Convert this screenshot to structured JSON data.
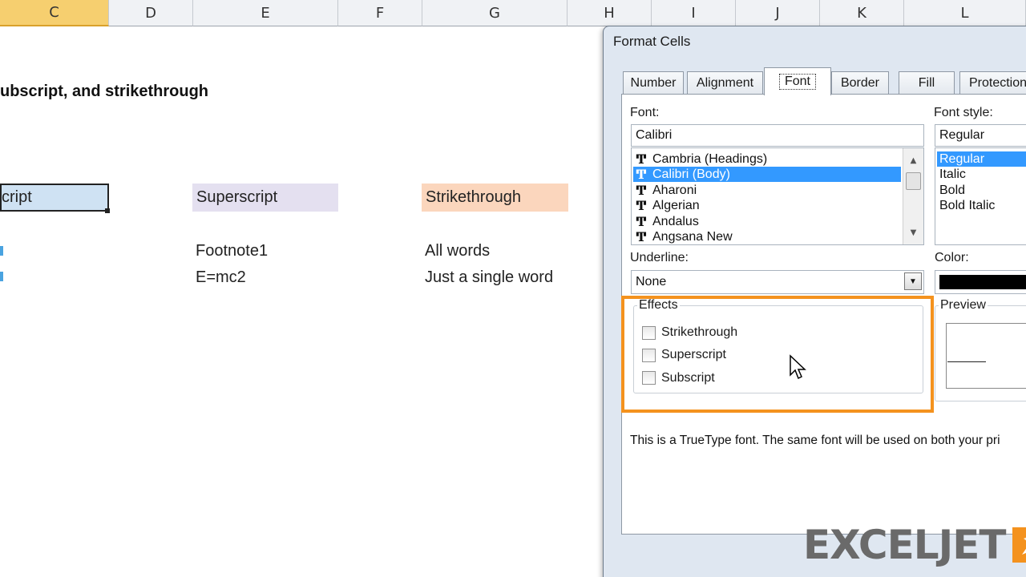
{
  "columns": {
    "C": "C",
    "D": "D",
    "E": "E",
    "F": "F",
    "G": "G",
    "H": "H",
    "I": "I",
    "J": "J",
    "K": "K",
    "L": "L"
  },
  "sheet": {
    "title": "ubscript, and strikethrough",
    "header_subscript": "cript",
    "header_superscript": "Superscript",
    "header_strikethrough": "Strikethrough",
    "superscript_examples": [
      "Footnote1",
      "E=mc2"
    ],
    "strikethrough_examples": [
      "All words",
      "Just a single word"
    ],
    "colors": {
      "subscript_fill": "#cfe2f3",
      "superscript_fill": "#e4e0f0",
      "strikethrough_fill": "#fbd6bd"
    }
  },
  "dialog": {
    "title": "Format Cells",
    "tabs": [
      "Number",
      "Alignment",
      "Font",
      "Border",
      "Fill",
      "Protection"
    ],
    "active_tab": "Font",
    "font_label": "Font:",
    "font_value": "Calibri",
    "font_list": [
      "Cambria (Headings)",
      "Calibri (Body)",
      "Aharoni",
      "Algerian",
      "Andalus",
      "Angsana New"
    ],
    "selected_font": "Calibri (Body)",
    "font_style_label": "Font style:",
    "font_style_value": "Regular",
    "font_styles": [
      "Regular",
      "Italic",
      "Bold",
      "Bold Italic"
    ],
    "selected_font_style": "Regular",
    "underline_label": "Underline:",
    "underline_value": "None",
    "color_label": "Color:",
    "color_value": "#000000",
    "effects_label": "Effects",
    "effects": {
      "strikethrough": "Strikethrough",
      "superscript": "Superscript",
      "subscript": "Subscript"
    },
    "preview_label": "Preview",
    "info_text": "This is a TrueType font.  The same font will be used on both your pri"
  },
  "highlight_color": "#f4921e",
  "logo": {
    "text": "EXCELJET"
  }
}
